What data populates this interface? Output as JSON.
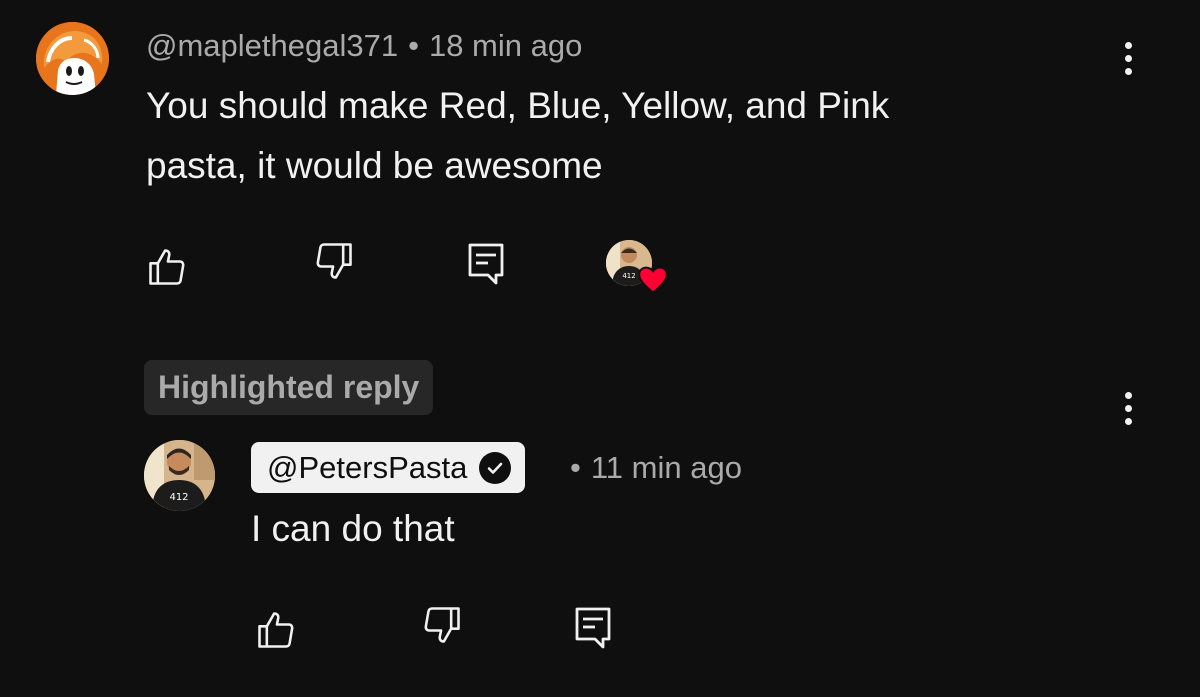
{
  "comment": {
    "author": "@maplethegal371",
    "separator": "•",
    "time": "18 min ago",
    "text_line1": "You should make Red, Blue, Yellow, and Pink",
    "text_line2": "pasta, it would be awesome",
    "avatar_icon": "cartoon-avatar-icon",
    "creator_heart_icon": "creator-heart-icon",
    "heart_color": "#ff0033"
  },
  "highlight": {
    "label": "Highlighted reply"
  },
  "reply": {
    "author": "@PetersPasta",
    "separator": "•",
    "time": "11 min ago",
    "text": "I can do that",
    "badge_jersey_number": "412"
  },
  "icons": {
    "like": "thumbs-up-icon",
    "dislike": "thumbs-down-icon",
    "reply": "reply-comment-icon",
    "menu": "more-vertical-icon",
    "verified": "verified-check-icon"
  },
  "colors": {
    "background": "#0f0f0f",
    "primary_text": "#f1f1f1",
    "secondary_text": "#aaaaaa",
    "badge_bg": "#272727"
  }
}
